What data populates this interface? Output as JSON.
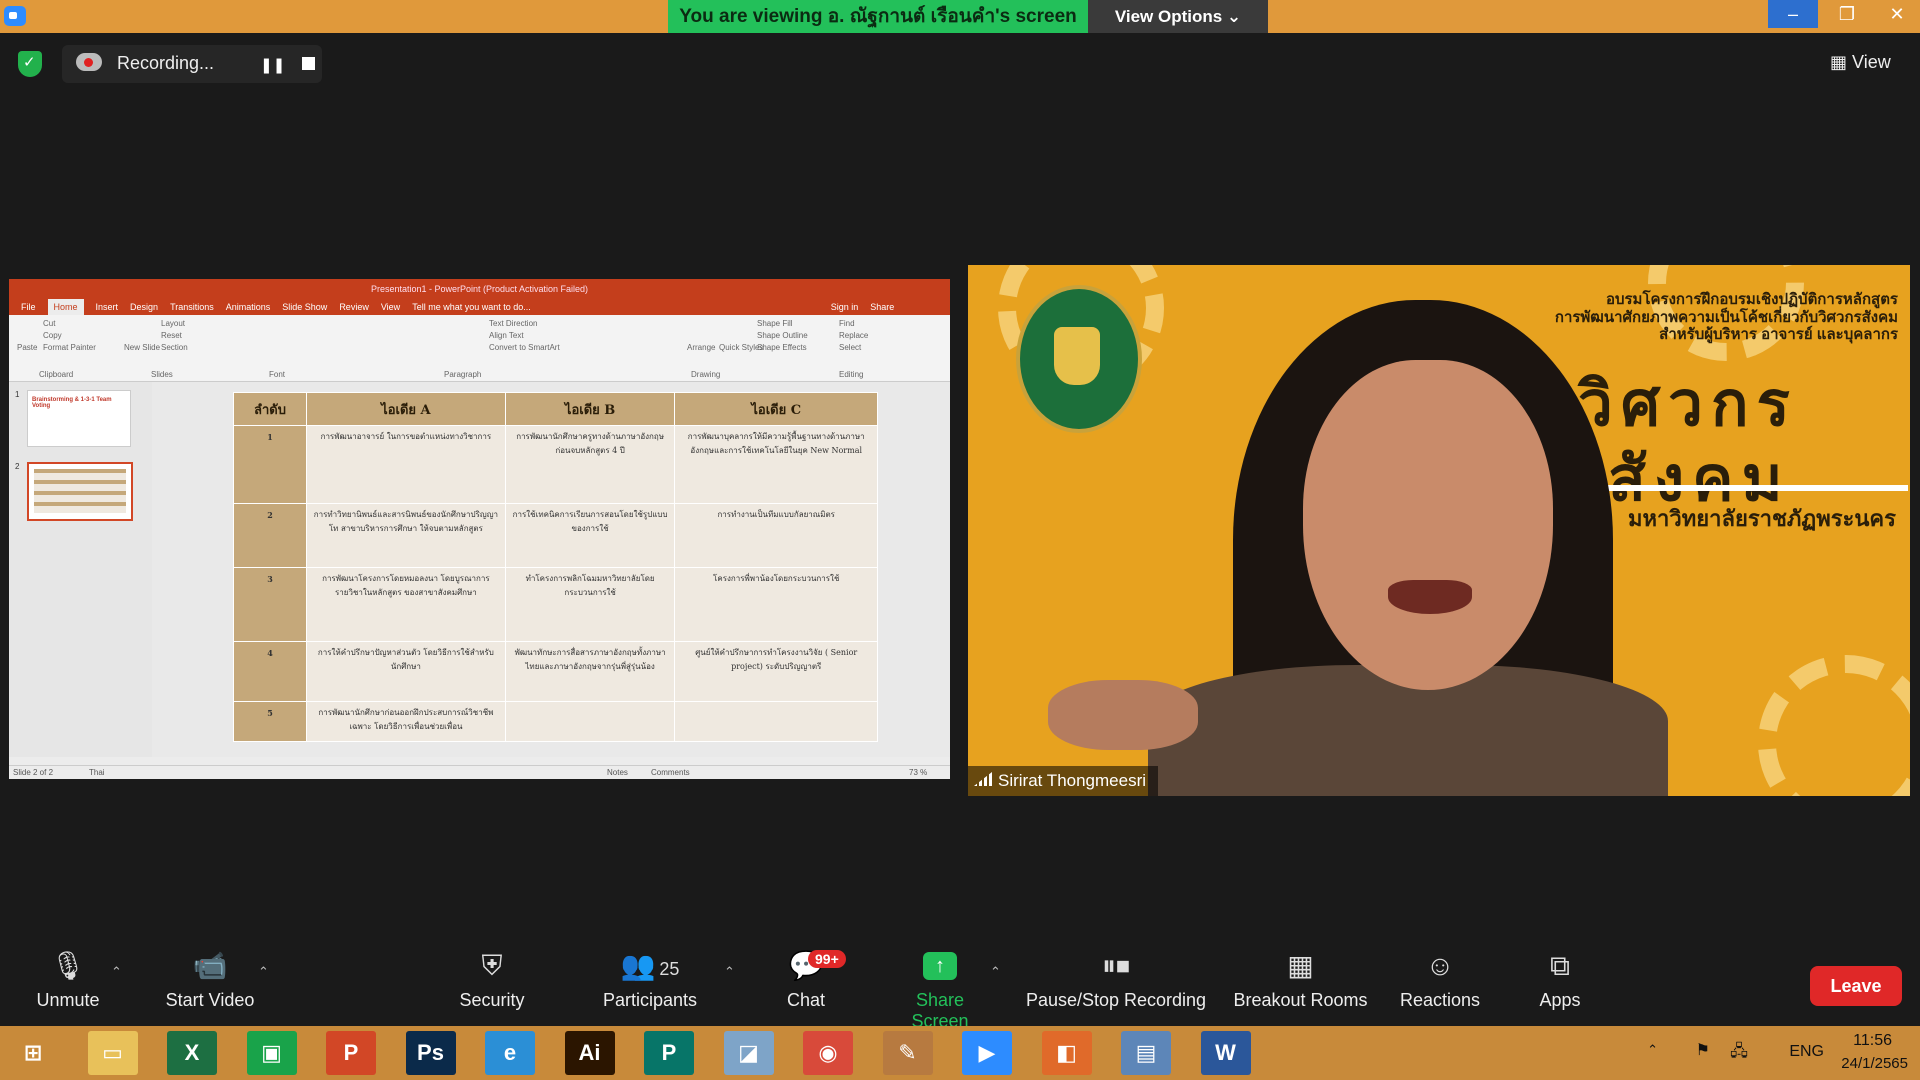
{
  "window": {
    "banner": "You are viewing อ. ณัฐกานต์ เรือนคำ's screen",
    "view_options": "View Options ⌄",
    "minimize": "–",
    "maximize": "❐",
    "close": "✕"
  },
  "recording": {
    "label": "Recording...",
    "pause": "❚❚",
    "view": "▦ View"
  },
  "ppt": {
    "title": "Presentation1 - PowerPoint (Product Activation Failed)",
    "tabs": [
      "File",
      "Home",
      "Insert",
      "Design",
      "Transitions",
      "Animations",
      "Slide Show",
      "Review",
      "View",
      "Tell me what you want to do...",
      "Sign in",
      "Share"
    ],
    "groups": [
      "Clipboard",
      "Slides",
      "Font",
      "Paragraph",
      "Drawing",
      "Editing"
    ],
    "ribbon_labels": [
      "Paste",
      "Cut",
      "Copy",
      "Format Painter",
      "New Slide",
      "Layout",
      "Reset",
      "Section",
      "Text Direction",
      "Align Text",
      "Convert to SmartArt",
      "Arrange",
      "Quick Styles",
      "Shape Fill",
      "Shape Outline",
      "Shape Effects",
      "Find",
      "Replace",
      "Select"
    ],
    "thumb_nums": [
      "1",
      "2"
    ],
    "thumb1_text": "Brainstorming & 1-3-1 Team Voting",
    "table_headers": [
      "ลำดับ",
      "ไอเดีย A",
      "ไอเดีย B",
      "ไอเดีย C"
    ],
    "table_rows": [
      {
        "num": "1",
        "a": "การพัฒนาอาจารย์ ในการขอตำแหน่งทางวิชาการ",
        "b": "การพัฒนานักศึกษาครูทางด้านภาษาอังกฤษก่อนจบหลักสูตร 4 ปี",
        "c": "การพัฒนาบุคลากรให้มีความรู้พื้นฐานทางด้านภาษาอังกฤษและการใช้เทคโนโลยีในยุค New Normal"
      },
      {
        "num": "2",
        "a": "การทำวิทยานิพนธ์และสารนิพนธ์ของนักศึกษาปริญญาโท สาขาบริหารการศึกษา ให้จบตามหลักสูตร",
        "b": "การใช้เทคนิคการเรียนการสอนโดยใช้รูปแบบของการใช้",
        "c": "การทำงานเป็นทีมแบบกัลยาณมิตร"
      },
      {
        "num": "3",
        "a": "การพัฒนาโครงการโดยหมอลงนา โดยบูรณาการรายวิชาในหลักสูตร ของสาขาสังคมศึกษา",
        "b": "ทำโครงการพลิกโฉมมหาวิทยาลัยโดยกระบวนการใช้",
        "c": "โครงการพี่พาน้องโดยกระบวนการใช้"
      },
      {
        "num": "4",
        "a": "การให้คำปรึกษาปัญหาส่วนตัว โดยวิธีการใช้สำหรับนักศึกษา",
        "b": "พัฒนาทักษะการสื่อสารภาษาอังกฤษทั้งภาษาไทยและภาษาอังกฤษจากรุ่นพี่สู่รุ่นน้อง",
        "c": "ศูนย์ให้คำปรึกษาการทำโครงงานวิจัย ( Senior project) ระดับปริญญาตรี"
      },
      {
        "num": "5",
        "a": "การพัฒนานักศึกษาก่อนออกฝึกประสบการณ์วิชาชีพ เฉพาะ โดยวิธีการเพื่อนช่วยเพื่อน",
        "b": "",
        "c": ""
      }
    ],
    "status_left": "Slide 2 of 2",
    "status_lang": "Thai",
    "status_notes": "Notes",
    "status_comments": "Comments",
    "zoom": "73 %"
  },
  "video": {
    "banner_line1": "อบรมโครงการฝึกอบรมเชิงปฏิบัติการหลักสูตร",
    "banner_line2": "การพัฒนาศักยภาพความเป็นโค้ชเกี่ยวกับวิศวกรสังคม",
    "banner_line3": "สำหรับผู้บริหาร อาจารย์ และบุคลากร",
    "big1": "วิศวกร",
    "big2": "สังคม",
    "university": "มหาวิทยาลัยราชภัฏพระนคร",
    "participant_name": "Sirirat Thongmeesri"
  },
  "toolbar": {
    "unmute": "Unmute",
    "start_video": "Start Video",
    "security": "Security",
    "participants": "Participants",
    "participants_count": "25",
    "chat": "Chat",
    "chat_badge": "99+",
    "share": "Share Screen",
    "pause_stop": "Pause/Stop Recording",
    "breakout": "Breakout Rooms",
    "reactions": "Reactions",
    "apps": "Apps",
    "leave": "Leave",
    "caret": "⌃"
  },
  "taskbar": {
    "apps": [
      {
        "icon": "start-icon",
        "label": "⊞",
        "color": "#c88a3a"
      },
      {
        "icon": "explorer-icon",
        "label": "▭",
        "color": "#e8c15a"
      },
      {
        "icon": "excel-icon",
        "label": "X",
        "color": "#1d6f42"
      },
      {
        "icon": "store-icon",
        "label": "▣",
        "color": "#19a34a"
      },
      {
        "icon": "powerpoint-icon",
        "label": "P",
        "color": "#d24726"
      },
      {
        "icon": "photoshop-icon",
        "label": "Ps",
        "color": "#0b2a4a"
      },
      {
        "icon": "ie-icon",
        "label": "e",
        "color": "#2b8fd6"
      },
      {
        "icon": "illustrator-icon",
        "label": "Ai",
        "color": "#2b1500"
      },
      {
        "icon": "publisher-icon",
        "label": "P",
        "color": "#077568"
      },
      {
        "icon": "app-icon",
        "label": "◪",
        "color": "#7ea4c8"
      },
      {
        "icon": "chrome-icon",
        "label": "◉",
        "color": "#d84a3a"
      },
      {
        "icon": "paint-icon",
        "label": "✎",
        "color": "#b77a40"
      },
      {
        "icon": "zoom-icon",
        "label": "▶",
        "color": "#2d8cff"
      },
      {
        "icon": "presenter-icon",
        "label": "◧",
        "color": "#e06a2a"
      },
      {
        "icon": "remote-icon",
        "label": "▤",
        "color": "#5d86b8"
      },
      {
        "icon": "word-icon",
        "label": "W",
        "color": "#2b579a"
      }
    ],
    "lang": "ENG",
    "time": "11:56",
    "date": "24/1/2565"
  }
}
